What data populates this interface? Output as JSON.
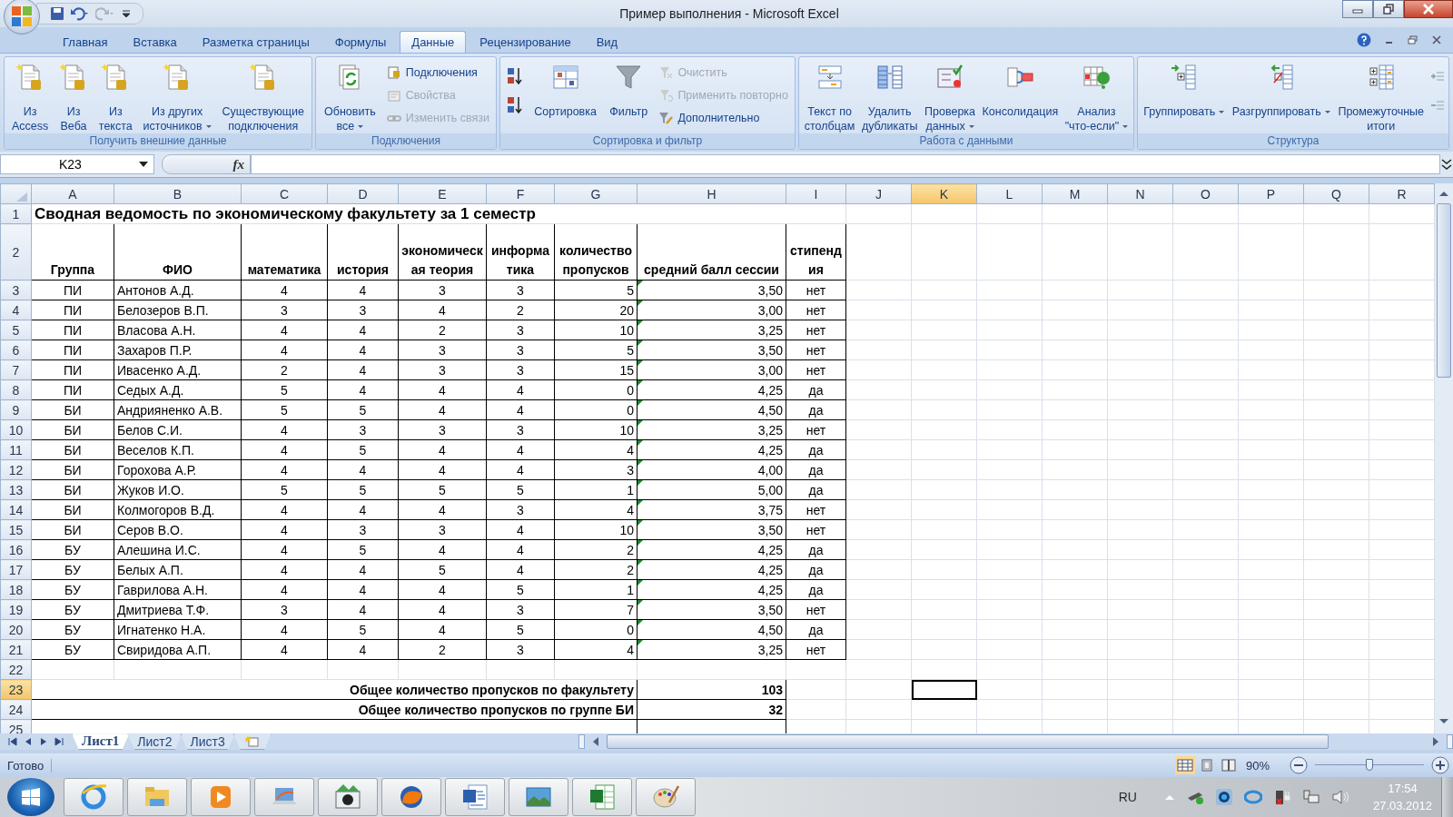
{
  "window": {
    "title": "Пример выполнения - Microsoft Excel"
  },
  "ribbon_tabs": [
    {
      "label": "Главная",
      "selected": false
    },
    {
      "label": "Вставка",
      "selected": false
    },
    {
      "label": "Разметка страницы",
      "selected": false
    },
    {
      "label": "Формулы",
      "selected": false
    },
    {
      "label": "Данные",
      "selected": true
    },
    {
      "label": "Рецензирование",
      "selected": false
    },
    {
      "label": "Вид",
      "selected": false
    }
  ],
  "ribbon_groups": [
    {
      "label": "Получить внешние данные",
      "buttons": [
        {
          "kind": "large",
          "label": "Из\nAccess"
        },
        {
          "kind": "large",
          "label": "Из\nВеба"
        },
        {
          "kind": "large",
          "label": "Из\nтекста"
        },
        {
          "kind": "large",
          "label": "Из других\nисточников",
          "dropdown": true
        },
        {
          "kind": "large",
          "label": "Существующие\nподключения"
        }
      ]
    },
    {
      "label": "Подключения",
      "buttons": [
        {
          "kind": "large",
          "label": "Обновить\nвсе",
          "dropdown": true
        },
        {
          "kind": "small",
          "label": "Подключения",
          "disabled": false
        },
        {
          "kind": "small",
          "label": "Свойства",
          "disabled": true
        },
        {
          "kind": "small",
          "label": "Изменить связи",
          "disabled": true
        }
      ]
    },
    {
      "label": "Сортировка и фильтр",
      "buttons": [
        {
          "kind": "icon"
        },
        {
          "kind": "icon"
        },
        {
          "kind": "large",
          "label": "Сортировка"
        },
        {
          "kind": "large",
          "label": "Фильтр"
        },
        {
          "kind": "small",
          "label": "Очистить",
          "disabled": true
        },
        {
          "kind": "small",
          "label": "Применить повторно",
          "disabled": true
        },
        {
          "kind": "small",
          "label": "Дополнительно",
          "disabled": false
        }
      ]
    },
    {
      "label": "Работа с данными",
      "buttons": [
        {
          "kind": "large",
          "label": "Текст по\nстолбцам"
        },
        {
          "kind": "large",
          "label": "Удалить\nдубликаты"
        },
        {
          "kind": "large",
          "label": "Проверка\nданных",
          "dropdown": true
        },
        {
          "kind": "large",
          "label": "Консолидация"
        },
        {
          "kind": "large",
          "label": "Анализ\n\"что-если\"",
          "dropdown": true
        }
      ]
    },
    {
      "label": "Структура",
      "buttons": [
        {
          "kind": "large",
          "label": "Группировать",
          "dropdown": true
        },
        {
          "kind": "large",
          "label": "Разгруппировать",
          "dropdown": true
        },
        {
          "kind": "large",
          "label": "Промежуточные\nитоги"
        },
        {
          "kind": "icon"
        },
        {
          "kind": "icon"
        }
      ]
    }
  ],
  "formula_bar": {
    "name_box": "K23",
    "function_button": "fx"
  },
  "sheet": {
    "columns": [
      {
        "label": "A",
        "selected": false
      },
      {
        "label": "B",
        "selected": false
      },
      {
        "label": "C",
        "selected": false
      },
      {
        "label": "D",
        "selected": false
      },
      {
        "label": "E",
        "selected": false
      },
      {
        "label": "F",
        "selected": false
      },
      {
        "label": "G",
        "selected": false
      },
      {
        "label": "H",
        "selected": false
      },
      {
        "label": "I",
        "selected": false
      },
      {
        "label": "J",
        "selected": false
      },
      {
        "label": "K",
        "selected": true
      },
      {
        "label": "L",
        "selected": false
      },
      {
        "label": "M",
        "selected": false
      },
      {
        "label": "N",
        "selected": false
      },
      {
        "label": "O",
        "selected": false
      },
      {
        "label": "P",
        "selected": false
      },
      {
        "label": "Q",
        "selected": false
      },
      {
        "label": "R",
        "selected": false
      }
    ],
    "rows": [
      {
        "row": "1",
        "kind": "title",
        "selected": false,
        "text": "Сводная ведомость по экономическому факультету за 1 семестр"
      },
      {
        "row": "2",
        "kind": "header",
        "selected": false,
        "cells": [
          "Группа",
          "ФИО",
          "математика",
          "история",
          "экономическая теория",
          "информатика",
          "количество пропусков",
          "средний балл сессии",
          "стипендия"
        ]
      },
      {
        "row": "3",
        "kind": "data",
        "selected": false,
        "flagged": true,
        "cells": [
          "ПИ",
          "Антонов А.Д.",
          "4",
          "4",
          "3",
          "3",
          "5",
          "3,50",
          "нет"
        ]
      },
      {
        "row": "4",
        "kind": "data",
        "selected": false,
        "flagged": true,
        "cells": [
          "ПИ",
          "Белозеров В.П.",
          "3",
          "3",
          "4",
          "2",
          "20",
          "3,00",
          "нет"
        ]
      },
      {
        "row": "5",
        "kind": "data",
        "selected": false,
        "flagged": true,
        "cells": [
          "ПИ",
          "Власова А.Н.",
          "4",
          "4",
          "2",
          "3",
          "10",
          "3,25",
          "нет"
        ]
      },
      {
        "row": "6",
        "kind": "data",
        "selected": false,
        "flagged": true,
        "cells": [
          "ПИ",
          "Захаров П.Р.",
          "4",
          "4",
          "3",
          "3",
          "5",
          "3,50",
          "нет"
        ]
      },
      {
        "row": "7",
        "kind": "data",
        "selected": false,
        "flagged": true,
        "cells": [
          "ПИ",
          "Ивасенко А.Д.",
          "2",
          "4",
          "3",
          "3",
          "15",
          "3,00",
          "нет"
        ]
      },
      {
        "row": "8",
        "kind": "data",
        "selected": false,
        "flagged": true,
        "cells": [
          "ПИ",
          "Седых А.Д.",
          "5",
          "4",
          "4",
          "4",
          "0",
          "4,25",
          "да"
        ]
      },
      {
        "row": "9",
        "kind": "data",
        "selected": false,
        "flagged": true,
        "cells": [
          "БИ",
          "Андрияненко А.В.",
          "5",
          "5",
          "4",
          "4",
          "0",
          "4,50",
          "да"
        ]
      },
      {
        "row": "10",
        "kind": "data",
        "selected": false,
        "flagged": true,
        "cells": [
          "БИ",
          "Белов С.И.",
          "4",
          "3",
          "3",
          "3",
          "10",
          "3,25",
          "нет"
        ]
      },
      {
        "row": "11",
        "kind": "data",
        "selected": false,
        "flagged": true,
        "cells": [
          "БИ",
          "Веселов К.П.",
          "4",
          "5",
          "4",
          "4",
          "4",
          "4,25",
          "да"
        ]
      },
      {
        "row": "12",
        "kind": "data",
        "selected": false,
        "flagged": true,
        "cells": [
          "БИ",
          "Горохова А.Р.",
          "4",
          "4",
          "4",
          "4",
          "3",
          "4,00",
          "да"
        ]
      },
      {
        "row": "13",
        "kind": "data",
        "selected": false,
        "flagged": true,
        "cells": [
          "БИ",
          "Жуков И.О.",
          "5",
          "5",
          "5",
          "5",
          "1",
          "5,00",
          "да"
        ]
      },
      {
        "row": "14",
        "kind": "data",
        "selected": false,
        "flagged": true,
        "cells": [
          "БИ",
          "Колмогоров В.Д.",
          "4",
          "4",
          "4",
          "3",
          "4",
          "3,75",
          "нет"
        ]
      },
      {
        "row": "15",
        "kind": "data",
        "selected": false,
        "flagged": true,
        "cells": [
          "БИ",
          "Серов В.О.",
          "4",
          "3",
          "3",
          "4",
          "10",
          "3,50",
          "нет"
        ]
      },
      {
        "row": "16",
        "kind": "data",
        "selected": false,
        "flagged": true,
        "cells": [
          "БУ",
          "Алешина И.С.",
          "4",
          "5",
          "4",
          "4",
          "2",
          "4,25",
          "да"
        ]
      },
      {
        "row": "17",
        "kind": "data",
        "selected": false,
        "flagged": true,
        "cells": [
          "БУ",
          "Белых А.П.",
          "4",
          "4",
          "5",
          "4",
          "2",
          "4,25",
          "да"
        ]
      },
      {
        "row": "18",
        "kind": "data",
        "selected": false,
        "flagged": true,
        "cells": [
          "БУ",
          "Гаврилова А.Н.",
          "4",
          "4",
          "4",
          "5",
          "1",
          "4,25",
          "да"
        ]
      },
      {
        "row": "19",
        "kind": "data",
        "selected": false,
        "flagged": true,
        "cells": [
          "БУ",
          "Дмитриева Т.Ф.",
          "3",
          "4",
          "4",
          "3",
          "7",
          "3,50",
          "нет"
        ]
      },
      {
        "row": "20",
        "kind": "data",
        "selected": false,
        "flagged": true,
        "cells": [
          "БУ",
          "Игнатенко Н.А.",
          "4",
          "5",
          "4",
          "5",
          "0",
          "4,50",
          "да"
        ]
      },
      {
        "row": "21",
        "kind": "data",
        "selected": false,
        "flagged": true,
        "cells": [
          "БУ",
          "Свиридова А.П.",
          "4",
          "4",
          "2",
          "3",
          "4",
          "3,25",
          "нет"
        ]
      },
      {
        "row": "22",
        "kind": "blank",
        "selected": false
      },
      {
        "row": "23",
        "kind": "total",
        "selected": true,
        "label": "Общее количество пропусков по факультету",
        "value": "103"
      },
      {
        "row": "24",
        "kind": "total",
        "selected": false,
        "label": "Общее количество пропусков по группе БИ",
        "value": "32"
      },
      {
        "row": "25",
        "kind": "cut",
        "selected": false
      }
    ]
  },
  "sheet_tabs": [
    {
      "label": "Лист1",
      "selected": true
    },
    {
      "label": "Лист2",
      "selected": false
    },
    {
      "label": "Лист3",
      "selected": false
    }
  ],
  "status_bar": {
    "text": "Готово",
    "views": [
      {
        "selected": true
      },
      {
        "selected": false
      },
      {
        "selected": false
      }
    ],
    "zoom": "90%",
    "zoom_slider": {
      "level": 0.5
    }
  },
  "taskbar": {
    "language": "RU",
    "time": "17:54",
    "date": "27.03.2012"
  }
}
